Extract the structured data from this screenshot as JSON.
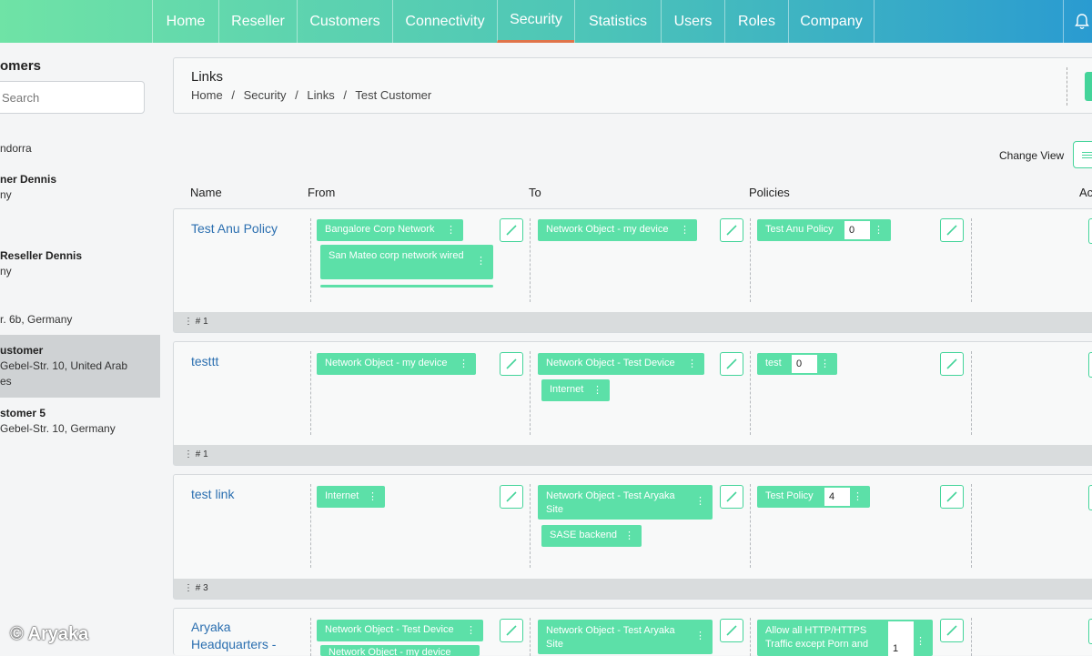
{
  "nav": {
    "items": [
      {
        "label": "Home"
      },
      {
        "label": "Reseller"
      },
      {
        "label": "Customers"
      },
      {
        "label": "Connectivity"
      },
      {
        "label": "Security"
      },
      {
        "label": "Statistics"
      },
      {
        "label": "Users"
      },
      {
        "label": "Roles"
      },
      {
        "label": "Company"
      }
    ],
    "active": "Security",
    "bell_icon": "bell-icon"
  },
  "sidebar": {
    "title": "omers",
    "search_placeholder": "Search",
    "entries": [
      {
        "name": "",
        "detail": "ndorra"
      },
      {
        "name": "ner Dennis",
        "detail": "ny"
      },
      {
        "name": "Reseller Dennis",
        "detail": "ny"
      },
      {
        "name": "",
        "detail": "r. 6b, Germany"
      },
      {
        "name": "ustomer",
        "detail": "Gebel-Str. 10, United Arab",
        "detail2": "es"
      },
      {
        "name": "stomer 5",
        "detail": "Gebel-Str. 10, Germany"
      }
    ]
  },
  "header": {
    "title": "Links",
    "breadcrumb": [
      "Home",
      "/",
      "Security",
      "/",
      "Links",
      "/",
      "Test Customer"
    ]
  },
  "view": {
    "change_view_label": "Change View"
  },
  "columns": {
    "name": "Name",
    "from": "From",
    "to": "To",
    "policies": "Policies",
    "actions": "Ac"
  },
  "links": [
    {
      "name": "Test Anu Policy",
      "from": [
        "Bangalore Corp Network",
        "San Mateo corp network wired"
      ],
      "to": [
        "Network Object - my device"
      ],
      "policy": {
        "label": "Test Anu Policy",
        "priority": "0"
      },
      "footer": "# 1"
    },
    {
      "name": "testtt",
      "from": [
        "Network Object - my device"
      ],
      "to": [
        "Network Object - Test Device",
        "Internet"
      ],
      "policy": {
        "label": "test",
        "priority": "0"
      },
      "footer": "# 1"
    },
    {
      "name": "test link",
      "from": [
        "Internet"
      ],
      "to": [
        "Network Object - Test Aryaka Site",
        "SASE backend"
      ],
      "policy": {
        "label": "Test Policy",
        "priority": "4"
      },
      "footer": "# 3"
    },
    {
      "name": "Aryaka Headquarters -",
      "from": [
        "Network Object - Test Device",
        "Network Object - my device"
      ],
      "to": [
        "Network Object - Test Aryaka Site"
      ],
      "policy": {
        "label": "Allow all HTTP/HTTPS Traffic except Porn and",
        "priority": "1"
      },
      "footer": ""
    }
  ],
  "watermark": "© Aryaka",
  "colors": {
    "accent": "#44d49a",
    "chip": "#5ce0a8",
    "link": "#2b6fb0",
    "nav_start": "#6fe3a6",
    "nav_end": "#2a9bd1",
    "active_underline": "#e0744a"
  }
}
